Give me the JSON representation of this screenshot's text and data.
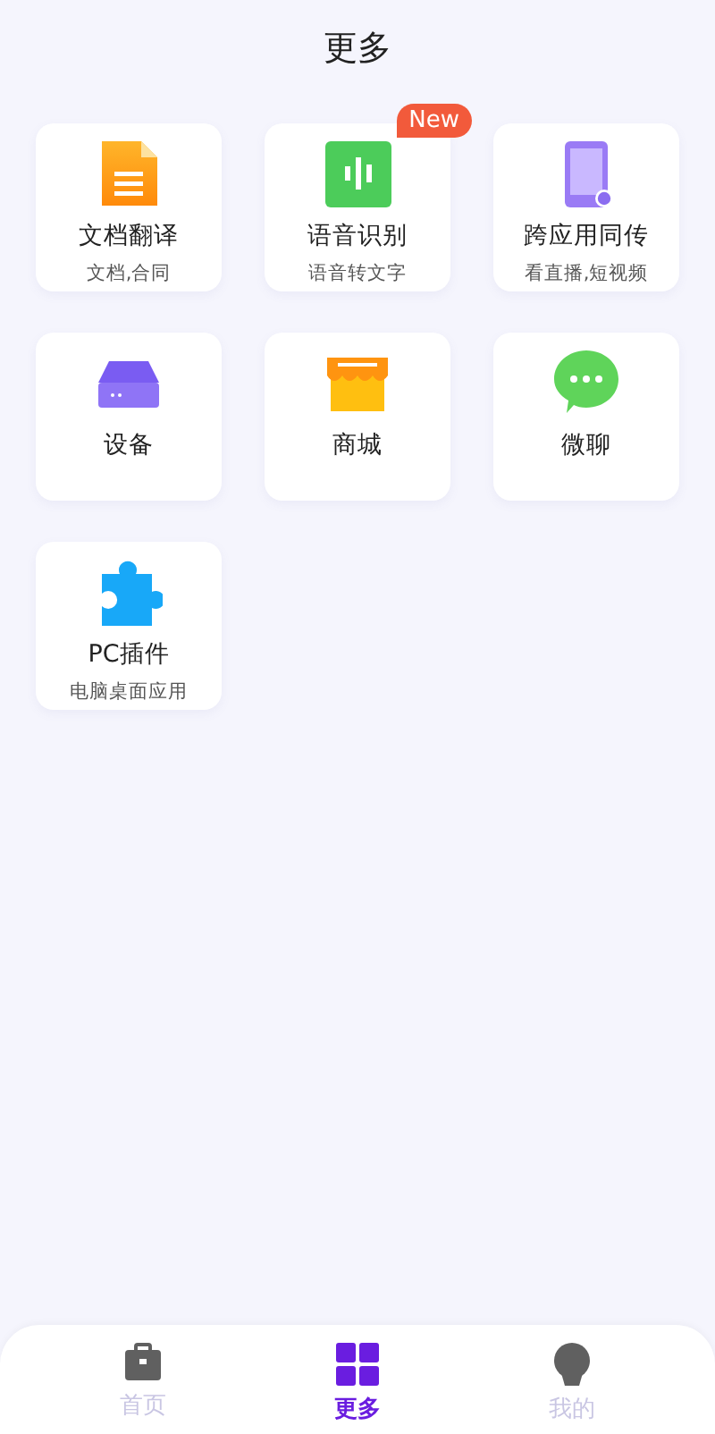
{
  "header": {
    "title": "更多"
  },
  "items": [
    {
      "kind": "document",
      "title": "文档翻译",
      "subtitle": "文档,合同"
    },
    {
      "kind": "voice",
      "title": "语音识别",
      "subtitle": "语音转文字",
      "badge": "New"
    },
    {
      "kind": "phone",
      "title": "跨应用同传",
      "subtitle": "看直播,短视频"
    },
    {
      "kind": "device",
      "title": "设备"
    },
    {
      "kind": "shop",
      "title": "商城"
    },
    {
      "kind": "chat",
      "title": "微聊"
    },
    {
      "kind": "plugin",
      "title": "PC插件",
      "subtitle": "电脑桌面应用"
    }
  ],
  "tab_bar": [
    {
      "kind": "home",
      "label": "首页",
      "selected": false
    },
    {
      "kind": "more",
      "label": "更多",
      "selected": true
    },
    {
      "kind": "me",
      "label": "我的",
      "selected": false
    }
  ]
}
